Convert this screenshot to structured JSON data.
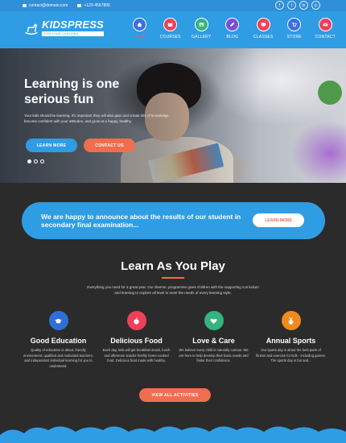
{
  "topbar": {
    "email": "contact@domain.com",
    "phone": "+123-4567890",
    "social": [
      {
        "icon": "facebook-icon",
        "glyph": "f"
      },
      {
        "icon": "twitter-icon",
        "glyph": "t"
      },
      {
        "icon": "linkedin-icon",
        "glyph": "in"
      },
      {
        "icon": "pinterest-icon",
        "glyph": "p"
      }
    ]
  },
  "logo": {
    "name": "KIDSPRESS",
    "tagline": "FOR YOUR CHILDREN"
  },
  "nav": [
    {
      "label": "HOME",
      "icon": "home-icon",
      "color": "#3b6fe0",
      "active": true
    },
    {
      "label": "COURSES",
      "icon": "book-icon",
      "color": "#ee4058"
    },
    {
      "label": "GALLERY",
      "icon": "image-icon",
      "color": "#36b37e"
    },
    {
      "label": "BLOG",
      "icon": "pencil-icon",
      "color": "#7a4fd8"
    },
    {
      "label": "CLASSES",
      "icon": "chalkboard-icon",
      "color": "#ee4058"
    },
    {
      "label": "STORE",
      "icon": "cart-icon",
      "color": "#3b6fe0"
    },
    {
      "label": "CONTACT",
      "icon": "mail-icon",
      "color": "#ee4058"
    }
  ],
  "hero": {
    "title_line1": "Learning is one",
    "title_line2": "serious fun",
    "description": "Your kids should be learning. It's important they will also gain and create lots of knowledge, become confident with your attitudes, and grow at a happy, healthy.",
    "btn_primary": "LEARN MORE",
    "btn_secondary": "CONTACT US",
    "slides": 3,
    "active_slide": 1
  },
  "announce": {
    "text": "We are happy to announce about the results of our student in secondary final examination...",
    "button": "LEARN MORE"
  },
  "learn": {
    "title": "Learn As You Play",
    "description": "Everything you need for a great year. Our diverse, programme gives children with the supporting curriculum and learning to explore all level to meet the needs of every learning style."
  },
  "features": [
    {
      "title": "Good Education",
      "icon": "graduation-cap-icon",
      "color": "#2f6fd8",
      "description": "Quality of education is about, friendly environment, qualified and motivated teachers, and independent individual learning for you to understand."
    },
    {
      "title": "Delicious Food",
      "icon": "apple-icon",
      "color": "#ee4058",
      "description": "Each day, kids will get breakfast snack, lunch and afternoon snacks freshly home-cooked food. Delicious food made with healthy."
    },
    {
      "title": "Love & Care",
      "icon": "heart-leaf-icon",
      "color": "#36b37e",
      "description": "We believe every child is naturally curious. We are here to help develop their basic needs and foster their confidence."
    },
    {
      "title": "Annual Sports",
      "icon": "medal-icon",
      "color": "#f08a1c",
      "description": "Our sports day is about the best parts of fitness and exercise for kids - including games. The sports day is fun and..."
    }
  ],
  "view_all": "VIEW ALL ACTIVITIES",
  "colors": {
    "brand_blue": "#2f9de4",
    "accent_orange": "#f06e4f",
    "dark_bg": "#2b2b2b"
  }
}
